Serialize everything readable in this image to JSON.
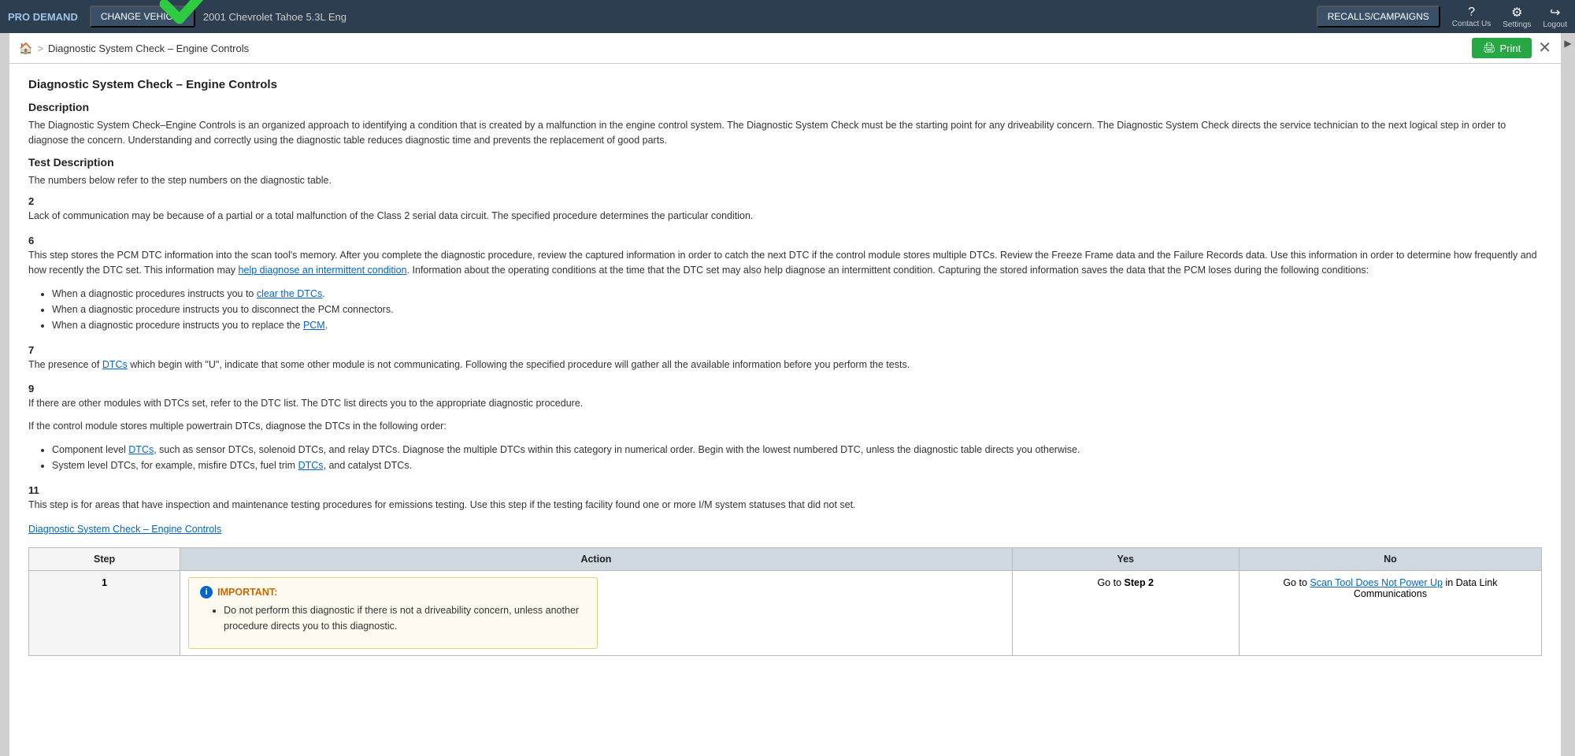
{
  "topNav": {
    "proDemand": "PRO DEMAND",
    "changeVehicle": "CHANGE VEHICLE",
    "vehicleInfo": "2001 Chevrolet Tahoe 5.3L Eng",
    "recalls": "RECALLS/CAMPAIGNS",
    "contactUs": "Contact Us",
    "settings": "Settings",
    "logout": "Logout"
  },
  "breadcrumb": {
    "home": "🏠",
    "separator": ">",
    "text": "Diagnostic System Check – Engine Controls"
  },
  "toolbar": {
    "print": "Print",
    "close": "✕"
  },
  "document": {
    "title": "Diagnostic System Check – Engine Controls",
    "descriptionHeading": "Description",
    "descriptionText": "The Diagnostic System Check–Engine Controls is an organized approach to identifying a condition that is created by a malfunction in the engine control system. The Diagnostic System Check must be the starting point for any driveability concern. The Diagnostic System Check directs the service technician to the next logical step in order to diagnose the concern. Understanding and correctly using the diagnostic table reduces diagnostic time and prevents the replacement of good parts.",
    "testDescHeading": "Test Description",
    "testDescIntro": "The numbers below refer to the step numbers on the diagnostic table.",
    "steps": [
      {
        "number": "2",
        "text": "Lack of communication may be because of a partial or a total malfunction of the Class 2 serial data circuit. The specified procedure determines the particular condition."
      },
      {
        "number": "6",
        "text": "This step stores the PCM DTC information into the scan tool's memory. After you complete the diagnostic procedure, review the captured information in order to catch the next DTC if the control module stores multiple DTCs. Review the Freeze Frame data and the Failure Records data. Use this information in order to determine how frequently and how recently the DTC set. This information may help diagnose an intermittent condition. Information about the operating conditions at the time that the DTC set may also help diagnose an intermittent condition. Capturing the stored information saves the data that the PCM loses during the following conditions:"
      },
      {
        "number": "7",
        "text": "The presence of DTCs which begin with \"U\", indicate that some other module is not communicating. Following the specified procedure will gather all the available information before you perform the tests."
      },
      {
        "number": "9",
        "text1": "If there are other modules with DTCs set, refer to the DTC list. The DTC list directs you to the appropriate diagnostic procedure.",
        "text2": "If the control module stores multiple powertrain DTCs, diagnose the DTCs in the following order:"
      },
      {
        "number": "11",
        "text": "This step is for areas that have inspection and maintenance testing procedures for emissions testing. Use this step if the testing facility found one or more I/M system statuses that did not set."
      }
    ],
    "bullets6": [
      "When a diagnostic procedures instructs you to clear the DTCs.",
      "When a diagnostic procedure instructs you to disconnect the PCM connectors.",
      "When a diagnostic procedure instructs you to replace the PCM."
    ],
    "bullets9": [
      "Component level DTCs, such as sensor DTCs, solenoid DTCs, and relay DTCs. Diagnose the multiple DTCs within this category in numerical order. Begin with the lowest numbered DTC, unless the diagnostic table directs you otherwise.",
      "System level DTCs, for example, misfire DTCs, fuel trim DTCs, and catalyst DTCs."
    ],
    "docLink": "Diagnostic System Check – Engine Controls",
    "tableHeaders": {
      "step": "Step",
      "action": "Action",
      "yes": "Yes",
      "no": "No"
    },
    "tableRows": [
      {
        "step": "1",
        "actionImportant": "IMPORTANT:",
        "actionText": "Do not perform this diagnostic if there is not a driveability concern, unless another procedure directs you to this diagnostic.",
        "yes": "Go to Step 2",
        "no": "Go to Scan Tool Does Not Power Up in Data Link Communications"
      }
    ]
  }
}
